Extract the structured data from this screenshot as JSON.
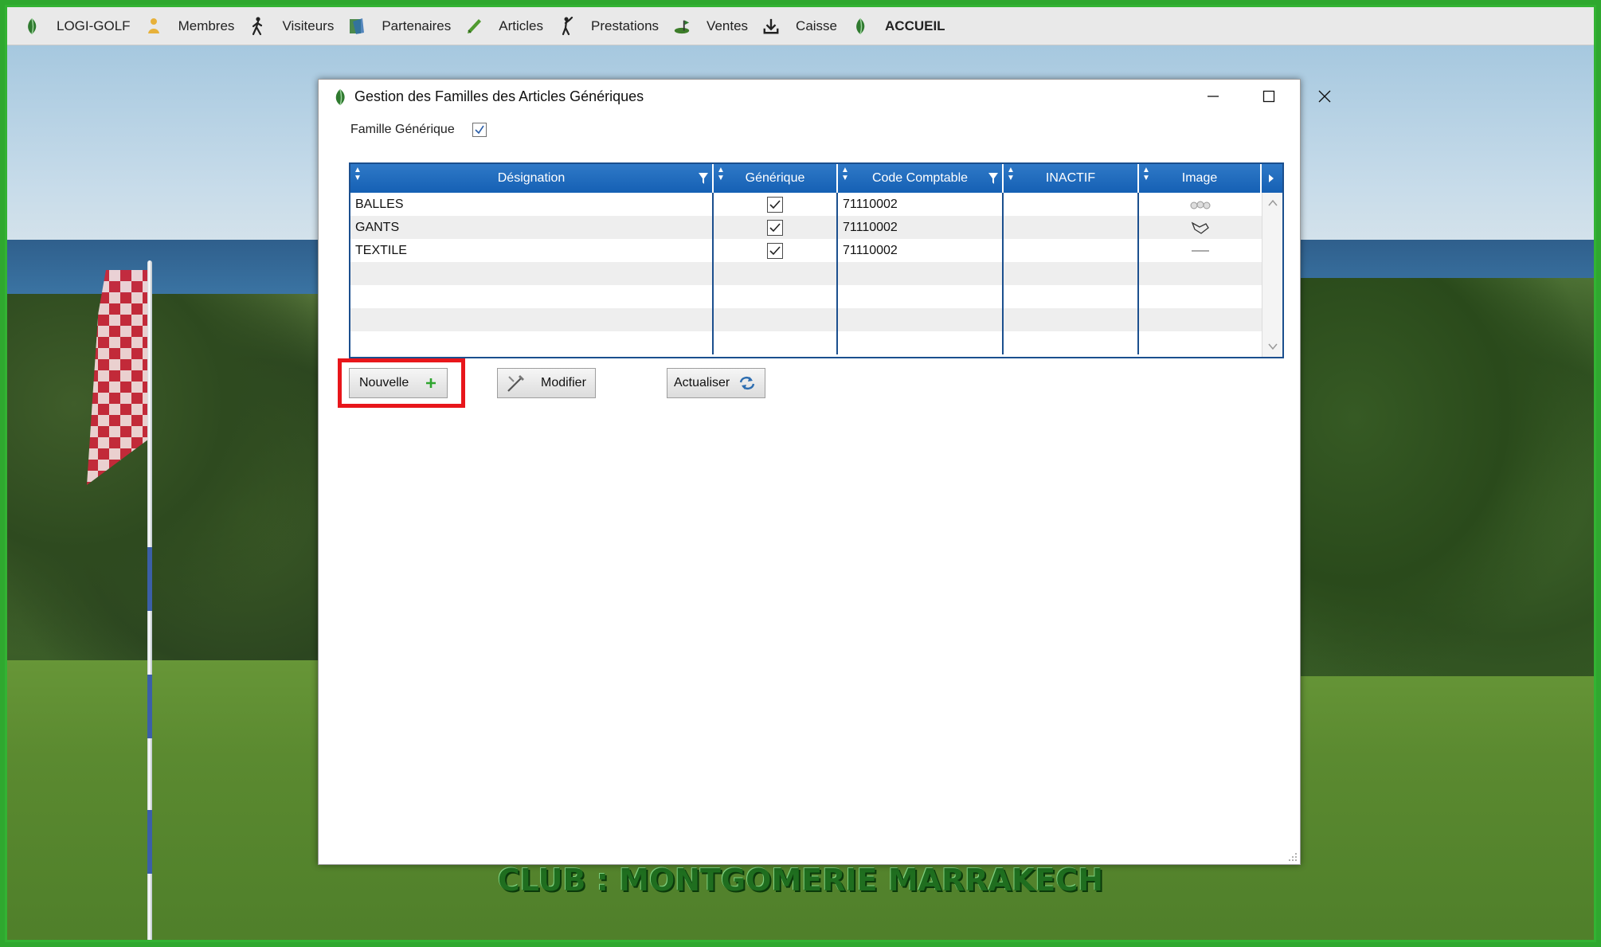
{
  "menubar": {
    "items": [
      {
        "label": "LOGI-GOLF",
        "icon": "golf-ball-leaf-icon"
      },
      {
        "label": "Membres",
        "icon": "member-icon"
      },
      {
        "label": "Visiteurs",
        "icon": "walking-person-icon"
      },
      {
        "label": "Partenaires",
        "icon": "partner-icon"
      },
      {
        "label": "Articles",
        "icon": "pen-icon"
      },
      {
        "label": "Prestations",
        "icon": "golfer-icon"
      },
      {
        "label": "Ventes",
        "icon": "golf-hole-icon"
      },
      {
        "label": "Caisse",
        "icon": "download-icon"
      },
      {
        "label": "ACCUEIL",
        "icon": "home-leaf-icon"
      }
    ]
  },
  "dialog": {
    "title": "Gestion des Familles des Articles Génériques",
    "famille_label": "Famille Générique",
    "famille_checked": true,
    "columns": [
      "Désignation",
      "Générique",
      "Code Comptable",
      "INACTIF",
      "Image"
    ],
    "rows": [
      {
        "designation": "BALLES",
        "generique": true,
        "code": "71110002",
        "inactif": "",
        "image": "golf-balls-thumbnail"
      },
      {
        "designation": "GANTS",
        "generique": true,
        "code": "71110002",
        "inactif": "",
        "image": "glove-thumbnail"
      },
      {
        "designation": "TEXTILE",
        "generique": true,
        "code": "71110002",
        "inactif": "",
        "image": "textile-thumbnail"
      }
    ],
    "empty_rows": 4,
    "buttons": {
      "nouvelle": "Nouvelle",
      "modifier": "Modifier",
      "actualiser": "Actualiser"
    }
  },
  "footer": {
    "club_title": "CLUB : MONTGOMERIE MARRAKECH"
  },
  "colors": {
    "accent": "#1560b4",
    "frame": "#33b333",
    "highlight": "#e8161b"
  }
}
